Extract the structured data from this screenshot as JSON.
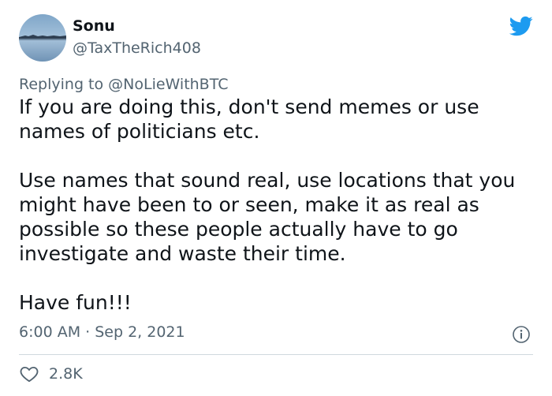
{
  "author": {
    "display_name": "Sonu",
    "handle": "@TaxTheRich408",
    "avatar_icon": "lake-landscape-avatar"
  },
  "platform_icon": "twitter-bird-icon",
  "reply": {
    "prefix": "Replying to ",
    "mention": "@NoLieWithBTC"
  },
  "tweet": {
    "paragraphs": [
      "If you are doing this, don't send memes or use names of politicians etc.",
      "Use names that sound real, use locations that you might have been to or seen, make it as real as possible so these people actually have to go investigate and waste their time.",
      "Have fun!!!"
    ],
    "timestamp": "6:00 AM · Sep 2, 2021"
  },
  "engagement": {
    "likes": "2.8K"
  },
  "colors": {
    "text": "#0f1419",
    "secondary": "#536471",
    "twitter_blue": "#1d9bf0",
    "divider": "#cfd9de"
  }
}
